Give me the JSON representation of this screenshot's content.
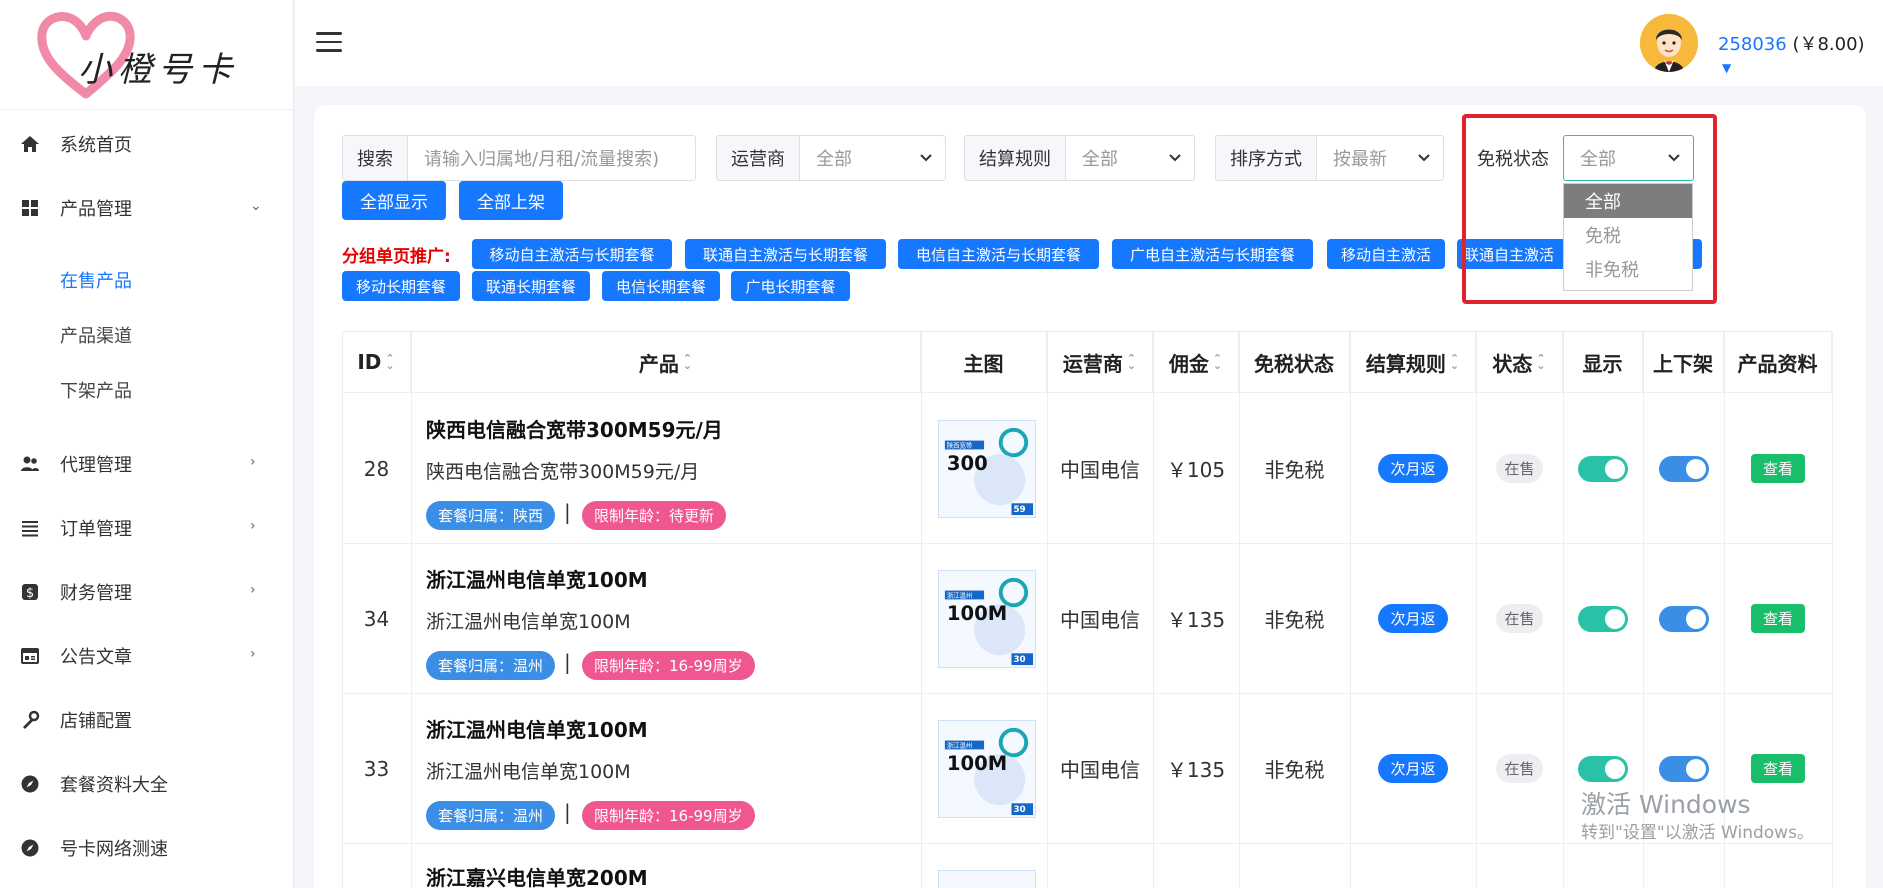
{
  "brand": {
    "logo_text": "小橙号卡"
  },
  "sidebar": {
    "items": [
      {
        "label": "系统首页",
        "icon": "home-icon"
      },
      {
        "label": "产品管理",
        "icon": "grid-icon"
      },
      {
        "label": "代理管理",
        "icon": "users-icon"
      },
      {
        "label": "订单管理",
        "icon": "list-icon"
      },
      {
        "label": "财务管理",
        "icon": "dollar-icon"
      },
      {
        "label": "公告文章",
        "icon": "article-icon"
      },
      {
        "label": "店铺配置",
        "icon": "tools-icon"
      },
      {
        "label": "套餐资料大全",
        "icon": "compass-icon"
      },
      {
        "label": "号卡网络测速",
        "icon": "compass-icon"
      }
    ],
    "sub_items": [
      "在售产品",
      "产品渠道",
      "下架产品"
    ]
  },
  "header": {
    "user_id": "258036",
    "balance": "(￥8.00)"
  },
  "filters": {
    "search_label": "搜索",
    "search_placeholder": "请输入归属地/月租/流量搜索)",
    "carrier_label": "运营商",
    "carrier_value": "全部",
    "settle_label": "结算规则",
    "settle_value": "全部",
    "sort_label": "排序方式",
    "sort_value": "按最新",
    "tax_label": "免税状态",
    "tax_value": "全部",
    "tax_options": [
      "全部",
      "免税",
      "非免税"
    ]
  },
  "buttons": {
    "show_all": "全部显示",
    "list_all": "全部上架"
  },
  "promo": {
    "label": "分组单页推广:",
    "tags": [
      "移动自主激活与长期套餐",
      "联通自主激活与长期套餐",
      "电信自主激活与长期套餐",
      "广电自主激活与长期套餐",
      "移动自主激活",
      "联通自主激活",
      "移动长期套餐",
      "联通长期套餐",
      "电信长期套餐",
      "广电长期套餐"
    ]
  },
  "table": {
    "headers": [
      "ID",
      "产品",
      "主图",
      "运营商",
      "佣金",
      "免税状态",
      "结算规则",
      "状态",
      "显示",
      "上下架",
      "产品资料"
    ],
    "rows": [
      {
        "id": "28",
        "title": "陕西电信融合宽带300M59元/月",
        "subtitle": "陕西电信融合宽带300M59元/月",
        "region_tag": "套餐归属：陕西",
        "age_tag": "限制年龄：待更新",
        "sep": "|",
        "carrier": "中国电信",
        "commission": "￥105",
        "tax": "非免税",
        "settle": "次月返",
        "status": "在售",
        "action": "查看",
        "thumb": {
          "region": "陕西宽带",
          "speed": "300",
          "price": "59"
        }
      },
      {
        "id": "34",
        "title": "浙江温州电信单宽100M",
        "subtitle": "浙江温州电信单宽100M",
        "region_tag": "套餐归属：温州",
        "age_tag": "限制年龄：16-99周岁",
        "sep": "|",
        "carrier": "中国电信",
        "commission": "￥135",
        "tax": "非免税",
        "settle": "次月返",
        "status": "在售",
        "action": "查看",
        "thumb": {
          "region": "浙江温州",
          "speed": "100M",
          "price": "30"
        }
      },
      {
        "id": "33",
        "title": "浙江温州电信单宽100M",
        "subtitle": "浙江温州电信单宽100M",
        "region_tag": "套餐归属：温州",
        "age_tag": "限制年龄：16-99周岁",
        "sep": "|",
        "carrier": "中国电信",
        "commission": "￥135",
        "tax": "非免税",
        "settle": "次月返",
        "status": "在售",
        "action": "查看",
        "thumb": {
          "region": "浙江温州",
          "speed": "100M",
          "price": "30"
        }
      },
      {
        "id": "",
        "title": "浙江嘉兴电信单宽200M"
      }
    ]
  },
  "watermark": {
    "line1": "激活 Windows",
    "line2": "转到\"设置\"以激活 Windows。"
  },
  "colors": {
    "primary": "#1677ff",
    "toggle_green": "#2ac2a7",
    "toggle_blue": "#3a8ee6",
    "pink": "#f0568f",
    "success": "#19be6b",
    "highlight": "#e0242b"
  }
}
